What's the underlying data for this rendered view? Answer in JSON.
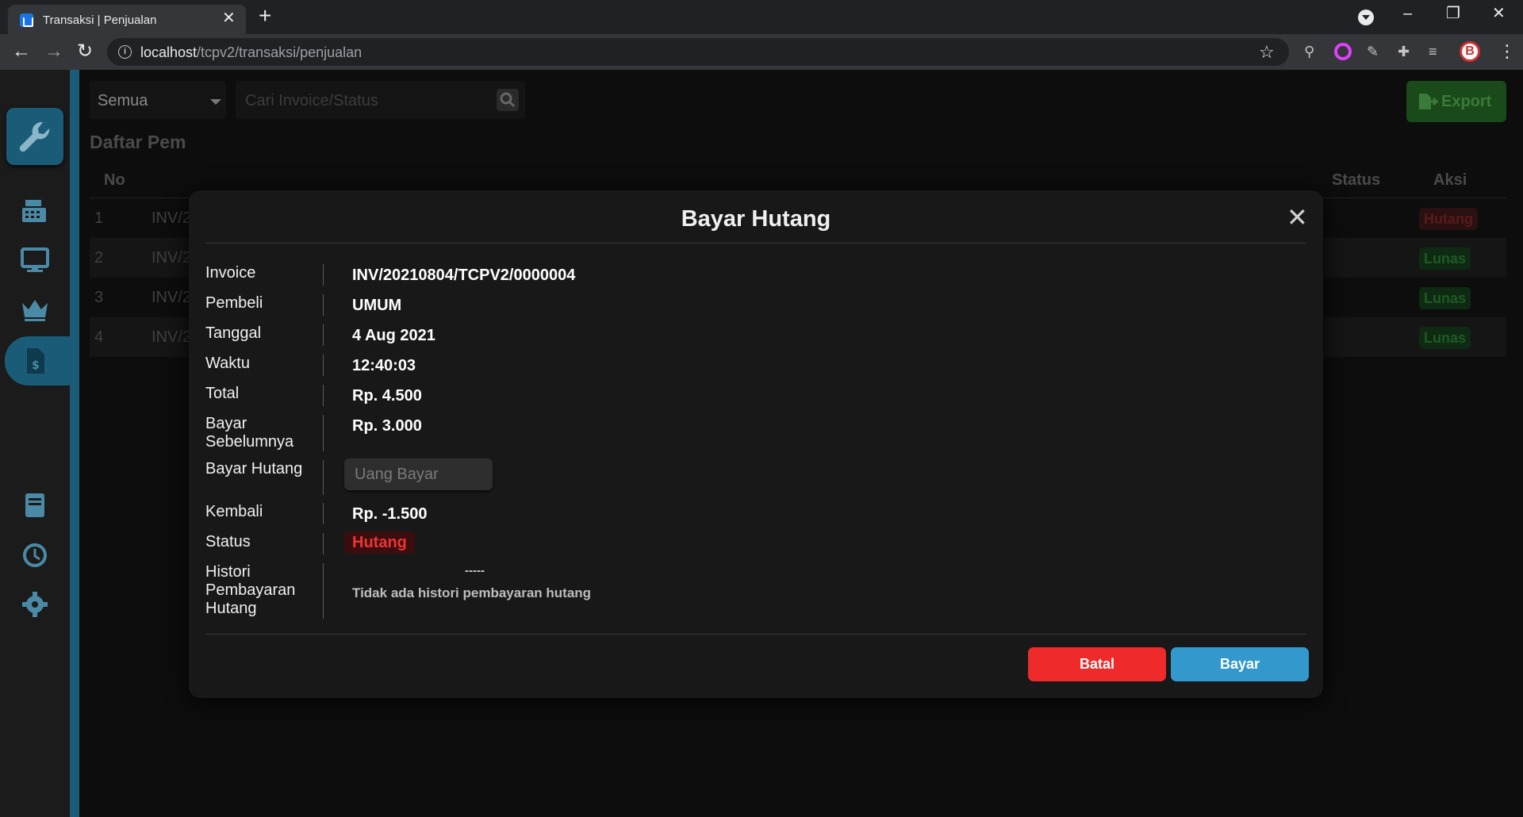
{
  "browser": {
    "tab_title": "Transaksi | Penjualan",
    "url_host": "localhost",
    "url_path": "/tcpv2/transaksi/penjualan"
  },
  "toolbar": {
    "filter_selected": "Semua",
    "search_placeholder": "Cari Invoice/Status",
    "export_label": "Export"
  },
  "page": {
    "heading": "Daftar Pem",
    "columns": {
      "no": "No",
      "status": "Status",
      "aksi": "Aksi"
    },
    "rows": [
      {
        "no": "1",
        "invoice": "INV/2",
        "status": "Hutang"
      },
      {
        "no": "2",
        "invoice": "INV/2",
        "status": "Lunas"
      },
      {
        "no": "3",
        "invoice": "INV/2",
        "status": "Lunas"
      },
      {
        "no": "4",
        "invoice": "INV/2",
        "status": "Lunas"
      }
    ]
  },
  "modal": {
    "title": "Bayar Hutang",
    "labels": {
      "invoice": "Invoice",
      "pembeli": "Pembeli",
      "tanggal": "Tanggal",
      "waktu": "Waktu",
      "total": "Total",
      "bayar_sebelumnya_1": "Bayar",
      "bayar_sebelumnya_2": "Sebelumnya",
      "bayar_hutang": "Bayar Hutang",
      "kembali": "Kembali",
      "status": "Status",
      "histori_1": "Histori",
      "histori_2": "Pembayaran",
      "histori_3": "Hutang"
    },
    "values": {
      "invoice": "INV/20210804/TCPV2/0000004",
      "pembeli": "UMUM",
      "tanggal": "4 Aug 2021",
      "waktu": "12:40:03",
      "total": "Rp. 4.500",
      "bayar_sebelumnya": "Rp. 3.000",
      "bayar_hutang_placeholder": "Uang Bayar",
      "kembali": "Rp. -1.500",
      "status": "Hutang",
      "histori_dash": "-----",
      "histori_empty": "Tidak ada histori pembayaran hutang"
    },
    "buttons": {
      "cancel": "Batal",
      "pay": "Bayar"
    }
  },
  "colors": {
    "accent": "#1a5c78",
    "danger": "#ee2a2a",
    "primary": "#3399cc",
    "success": "#1a4a1a"
  }
}
